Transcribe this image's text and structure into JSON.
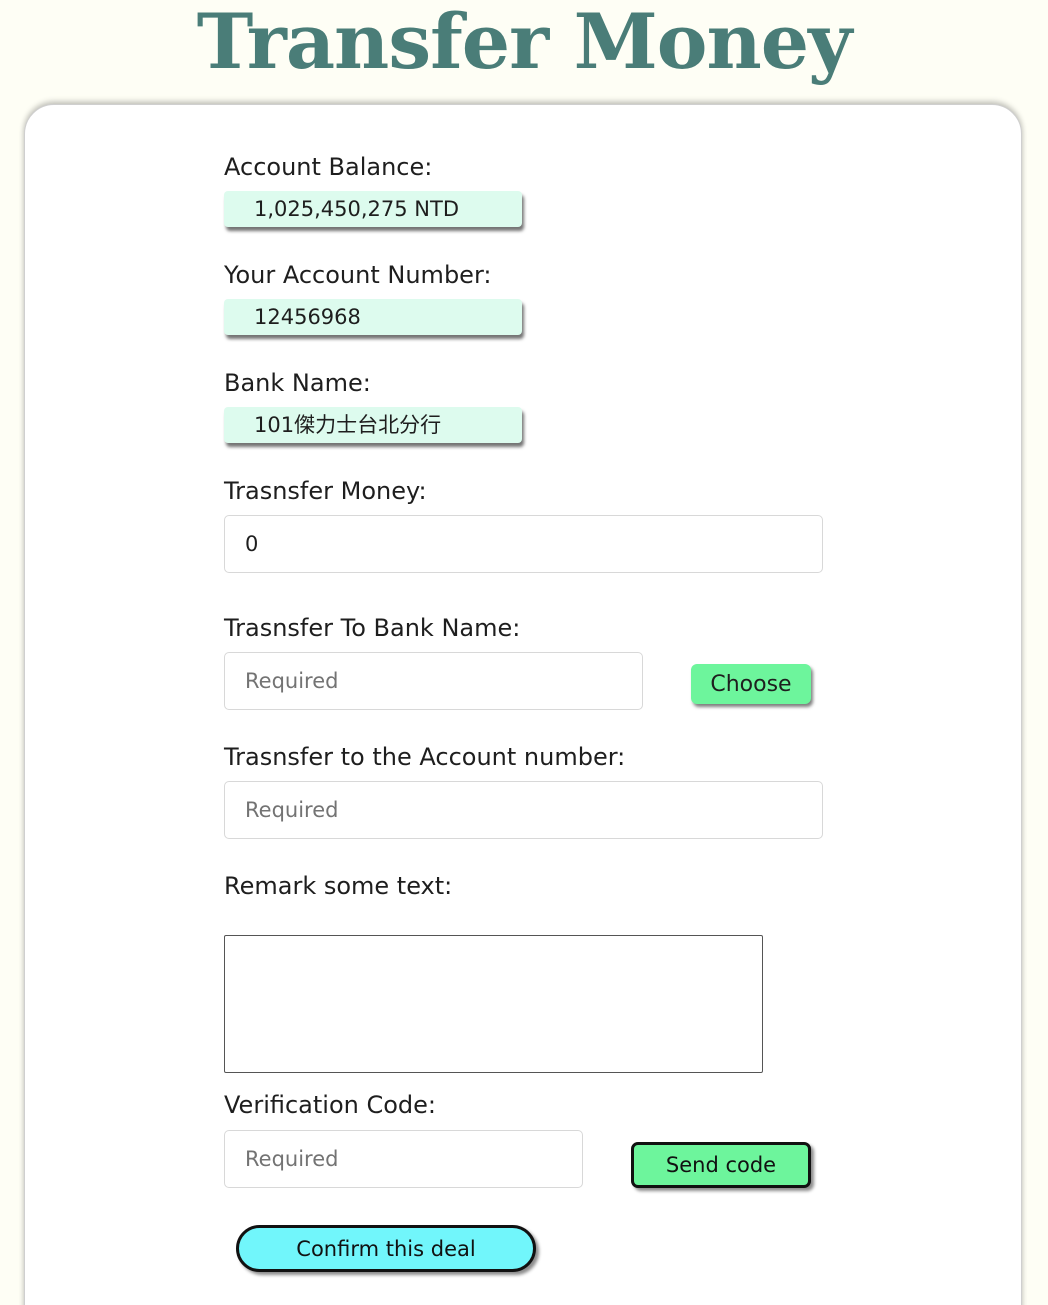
{
  "page": {
    "title": "Transfer Money"
  },
  "account_info": {
    "balance_label": "Account Balance:",
    "balance_value": "1,025,450,275 NTD",
    "account_number_label": "Your Account Number:",
    "account_number_value": "12456968",
    "bank_name_label": "Bank Name:",
    "bank_name_value": "101傑力士台北分行"
  },
  "form": {
    "transfer_money_label": "Trasnsfer Money:",
    "transfer_money_value": "0",
    "to_bank_label": "Trasnsfer To Bank Name:",
    "to_bank_placeholder": "Required",
    "choose_button": "Choose",
    "to_account_label": "Trasnsfer to the Account number:",
    "to_account_placeholder": "Required",
    "remark_label": "Remark some text:",
    "remark_value": "",
    "verification_label": "Verification Code:",
    "verification_placeholder": "Required",
    "send_code_button": "Send code",
    "confirm_button": "Confirm this deal"
  },
  "colors": {
    "title": "#4a7d78",
    "readonly_field": "#ddfbee",
    "green_button": "#6df59c",
    "confirm_button": "#71f6fb",
    "background": "#fefef5"
  }
}
